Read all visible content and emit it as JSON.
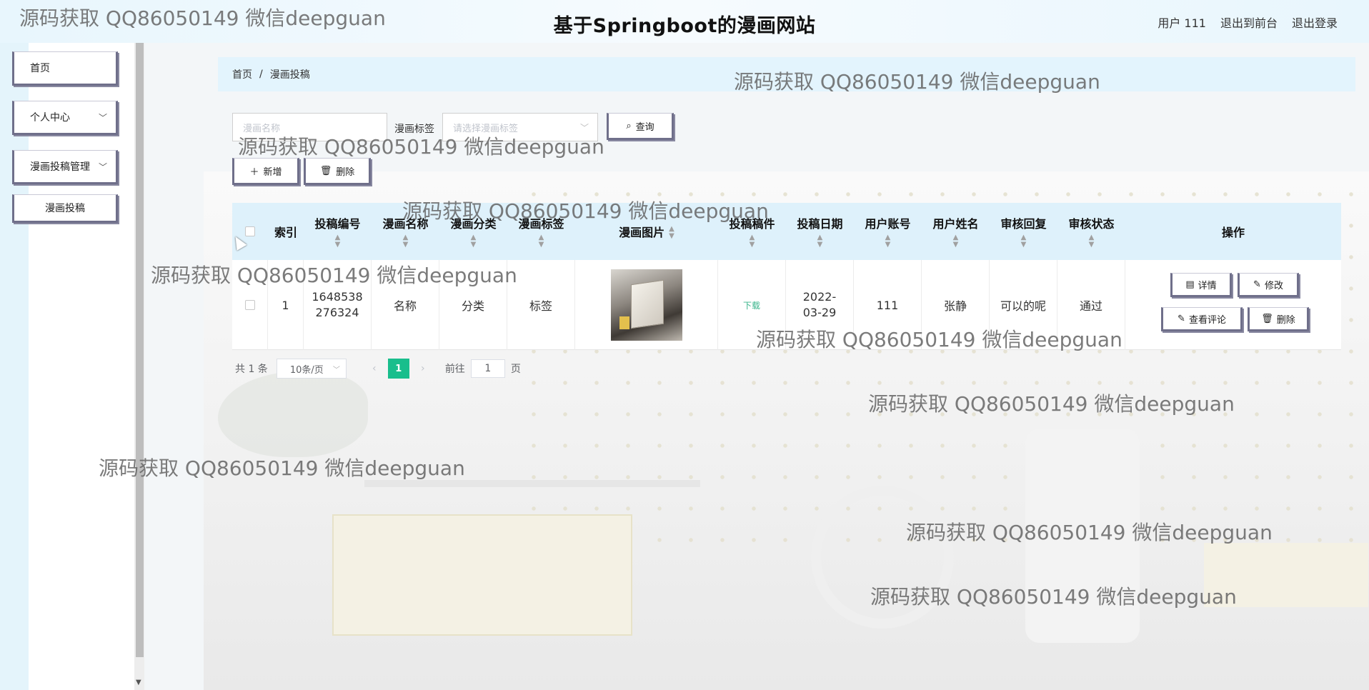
{
  "app_title": "基于Springboot的漫画网站",
  "top_nav": {
    "user": "用户 111",
    "front": "退出到前台",
    "logout": "退出登录"
  },
  "sidebar": {
    "home": "首页",
    "personal": "个人中心",
    "manage": "漫画投稿管理",
    "submission": "漫画投稿"
  },
  "breadcrumb": {
    "home": "首页",
    "sep": "/",
    "current": "漫画投稿"
  },
  "search": {
    "name_placeholder": "漫画名称",
    "tag_label": "漫画标签",
    "tag_placeholder": "请选择漫画标签",
    "query": "查询"
  },
  "actions": {
    "add": "新增",
    "delete": "删除"
  },
  "table": {
    "headers": {
      "index": "索引",
      "sub_no": "投稿编号",
      "name": "漫画名称",
      "category": "漫画分类",
      "tag": "漫画标签",
      "image": "漫画图片",
      "draft": "投稿稿件",
      "date": "投稿日期",
      "account": "用户账号",
      "username": "用户姓名",
      "reply": "审核回复",
      "status": "审核状态",
      "ops": "操作"
    },
    "rows": [
      {
        "index": "1",
        "sub_no": "1648538276324",
        "name": "名称",
        "category": "分类",
        "tag": "标签",
        "draft": "下载",
        "date": "2022-03-29",
        "account": "111",
        "username": "张静",
        "reply": "可以的呢",
        "status": "通过"
      }
    ],
    "ops": {
      "detail": "详情",
      "edit": "修改",
      "comments": "查看评论",
      "delete": "删除"
    }
  },
  "pagination": {
    "total": "共 1 条",
    "page_size": "10条/页",
    "current_page": "1",
    "goto_label": "前往",
    "goto_value": "1",
    "page_suffix": "页"
  },
  "watermark": "源码获取 QQ86050149 微信deepguan",
  "colors": {
    "accent": "#19be8c",
    "header_bg": "#def1fb",
    "button_border": "#6f6f8a"
  }
}
